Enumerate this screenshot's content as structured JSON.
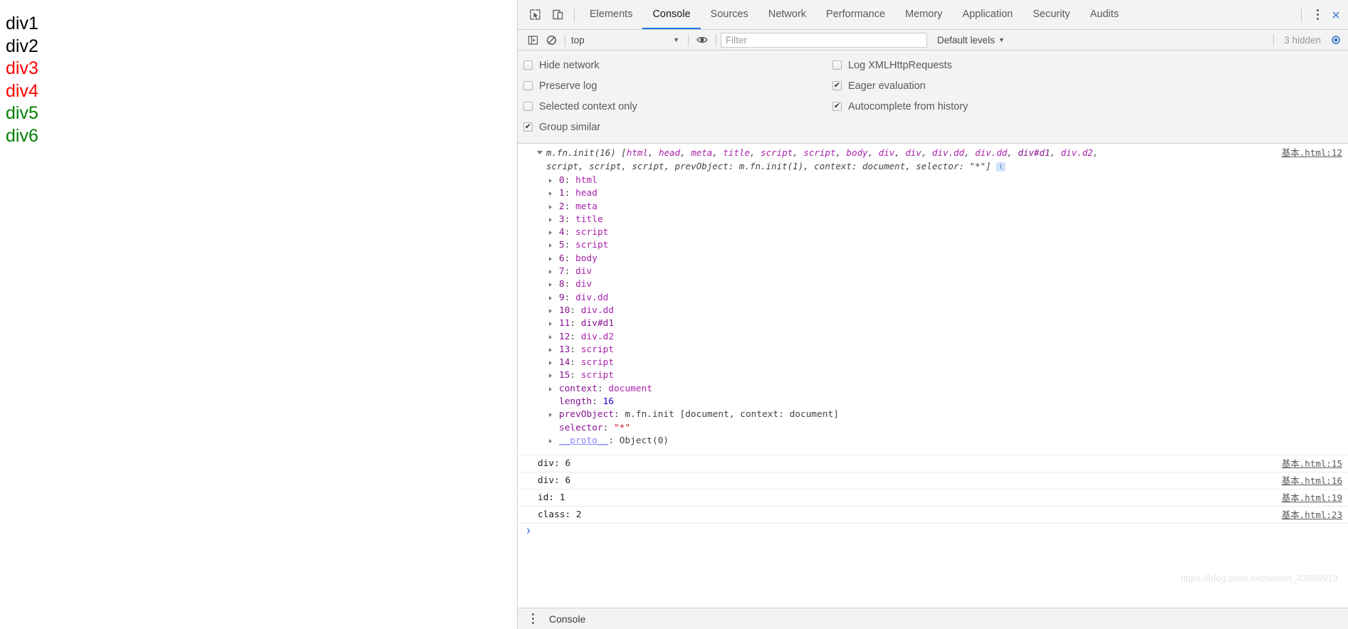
{
  "page": {
    "divs": [
      {
        "label": "div1",
        "color": "#000000"
      },
      {
        "label": "div2",
        "color": "#000000"
      },
      {
        "label": "div3",
        "color": "#ff0000"
      },
      {
        "label": "div4",
        "color": "#ff0000"
      },
      {
        "label": "div5",
        "color": "#008000"
      },
      {
        "label": "div6",
        "color": "#008000"
      }
    ]
  },
  "devtools": {
    "tabs": [
      {
        "label": "Elements",
        "active": false
      },
      {
        "label": "Console",
        "active": true
      },
      {
        "label": "Sources",
        "active": false
      },
      {
        "label": "Network",
        "active": false
      },
      {
        "label": "Performance",
        "active": false
      },
      {
        "label": "Memory",
        "active": false
      },
      {
        "label": "Application",
        "active": false
      },
      {
        "label": "Security",
        "active": false
      },
      {
        "label": "Audits",
        "active": false
      }
    ],
    "toolbar": {
      "inspect_icon": "inspect-element-icon",
      "device_icon": "device-toolbar-icon",
      "more_icon": "kebab-menu-icon",
      "close_icon": "close-devtools-icon"
    },
    "filterbar": {
      "sidebar_icon": "console-sidebar-icon",
      "clear_icon": "clear-console-icon",
      "context": "top",
      "eye_icon": "live-expression-icon",
      "filter_placeholder": "Filter",
      "levels": "Default levels",
      "hidden": "3 hidden",
      "settings_icon": "settings-gear-icon"
    },
    "settings": {
      "left": [
        {
          "label": "Hide network",
          "checked": false
        },
        {
          "label": "Preserve log",
          "checked": false
        },
        {
          "label": "Selected context only",
          "checked": false
        },
        {
          "label": "Group similar",
          "checked": true
        }
      ],
      "right": [
        {
          "label": "Log XMLHttpRequests",
          "checked": false
        },
        {
          "label": "Eager evaluation",
          "checked": true
        },
        {
          "label": "Autocomplete from history",
          "checked": true
        }
      ]
    },
    "console": {
      "group": {
        "source": "基本.html:12",
        "header_line1_prefix": "m.fn.init(16) [",
        "header_line1_items": [
          "html",
          "head",
          "meta",
          "title",
          "script",
          "script",
          "body",
          "div",
          "div",
          "div.dd",
          "div.dd",
          "div#d1",
          "div.d2",
          ""
        ],
        "header_line2": "script, script, script, prevObject: m.fn.init(1), context: document, selector: \"*\"]",
        "info_badge": "i"
      },
      "properties": [
        {
          "index": "0",
          "value": "html",
          "expandable": true
        },
        {
          "index": "1",
          "value": "head",
          "expandable": true
        },
        {
          "index": "2",
          "value": "meta",
          "expandable": true
        },
        {
          "index": "3",
          "value": "title",
          "expandable": true
        },
        {
          "index": "4",
          "value": "script",
          "expandable": true
        },
        {
          "index": "5",
          "value": "script",
          "expandable": true
        },
        {
          "index": "6",
          "value": "body",
          "expandable": true
        },
        {
          "index": "7",
          "value": "div",
          "expandable": true
        },
        {
          "index": "8",
          "value": "div",
          "expandable": true
        },
        {
          "index": "9",
          "value": "div.dd",
          "expandable": true
        },
        {
          "index": "10",
          "value": "div.dd",
          "expandable": true
        },
        {
          "index": "11",
          "value": "div#d1",
          "expandable": true
        },
        {
          "index": "12",
          "value": "div.d2",
          "expandable": true
        },
        {
          "index": "13",
          "value": "script",
          "expandable": true
        },
        {
          "index": "14",
          "value": "script",
          "expandable": true
        },
        {
          "index": "15",
          "value": "script",
          "expandable": true
        }
      ],
      "extra_properties": [
        {
          "key": "context",
          "value": "document",
          "expandable": true,
          "kind": "tag"
        },
        {
          "key": "length",
          "value": "16",
          "expandable": false,
          "kind": "num"
        },
        {
          "key": "prevObject",
          "value": "m.fn.init [document, context: document]",
          "expandable": true,
          "kind": "obj"
        },
        {
          "key": "selector",
          "value": "\"*\"",
          "expandable": false,
          "kind": "str"
        },
        {
          "key": "__proto__",
          "value": "Object(0)",
          "expandable": true,
          "kind": "proto"
        }
      ],
      "log_rows": [
        {
          "text": "div: 6",
          "source": "基本.html:15"
        },
        {
          "text": "div: 6",
          "source": "基本.html:16"
        },
        {
          "text": "id: 1",
          "source": "基本.html:19"
        },
        {
          "text": "class: 2",
          "source": "基本.html:23"
        }
      ],
      "prompt_caret": "❯"
    },
    "drawer": {
      "tab": "Console",
      "kebab_icon": "drawer-menu-icon"
    },
    "watermark": "https://blog.csdn.net/weixin_43889913"
  }
}
